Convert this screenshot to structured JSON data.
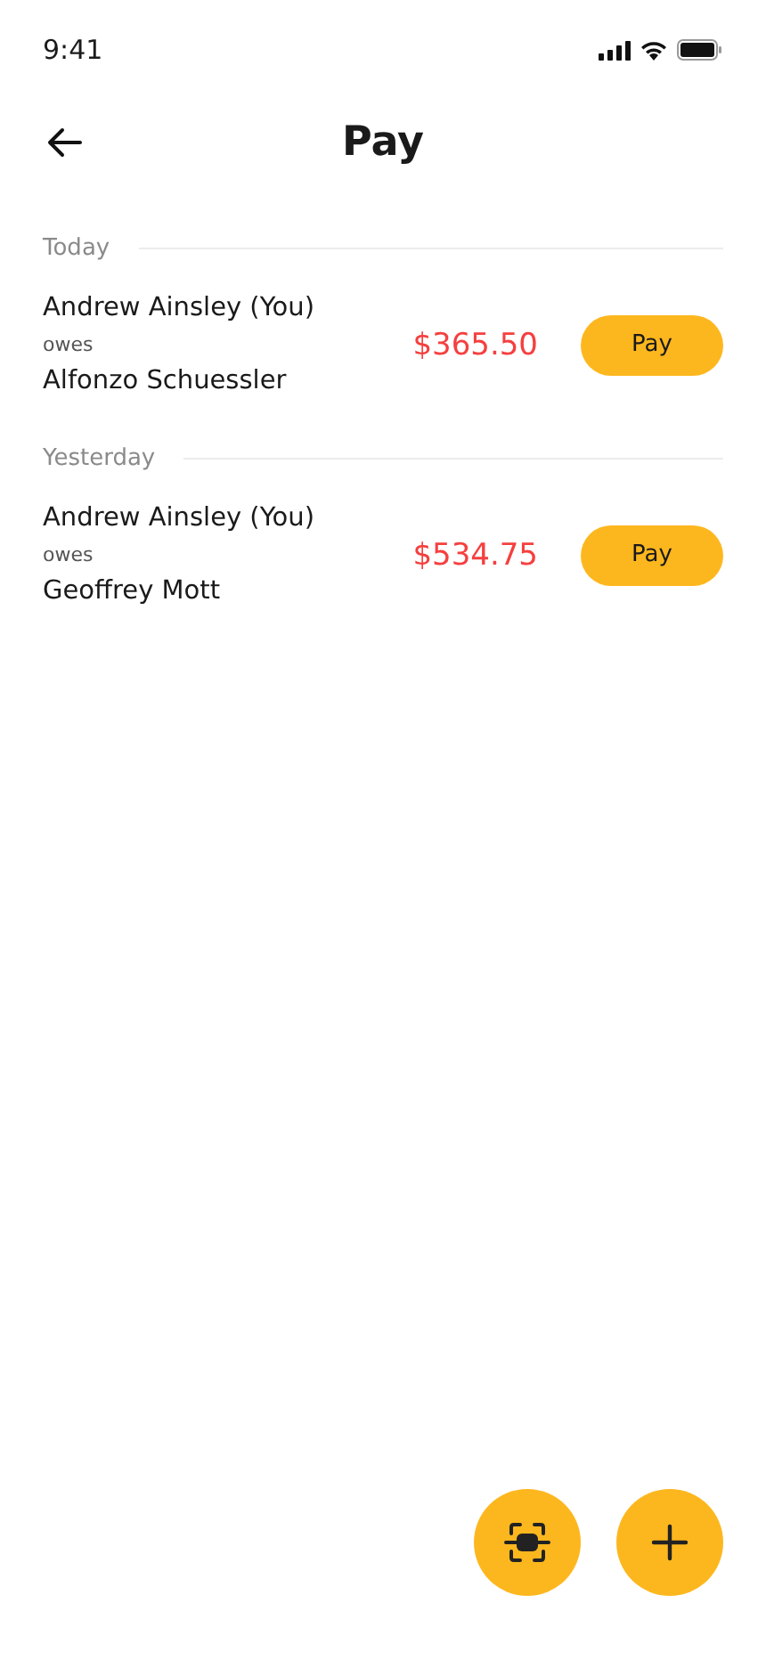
{
  "status_bar": {
    "time": "9:41"
  },
  "header": {
    "title": "Pay"
  },
  "sections": [
    {
      "heading": "Today",
      "items": [
        {
          "payer": "Andrew Ainsley (You)",
          "verb": "owes",
          "payee": "Alfonzo Schuessler",
          "amount": "$365.50",
          "action": "Pay"
        }
      ]
    },
    {
      "heading": "Yesterday",
      "items": [
        {
          "payer": "Andrew Ainsley (You)",
          "verb": "owes",
          "payee": "Geoffrey Mott",
          "amount": "$534.75",
          "action": "Pay"
        }
      ]
    }
  ]
}
